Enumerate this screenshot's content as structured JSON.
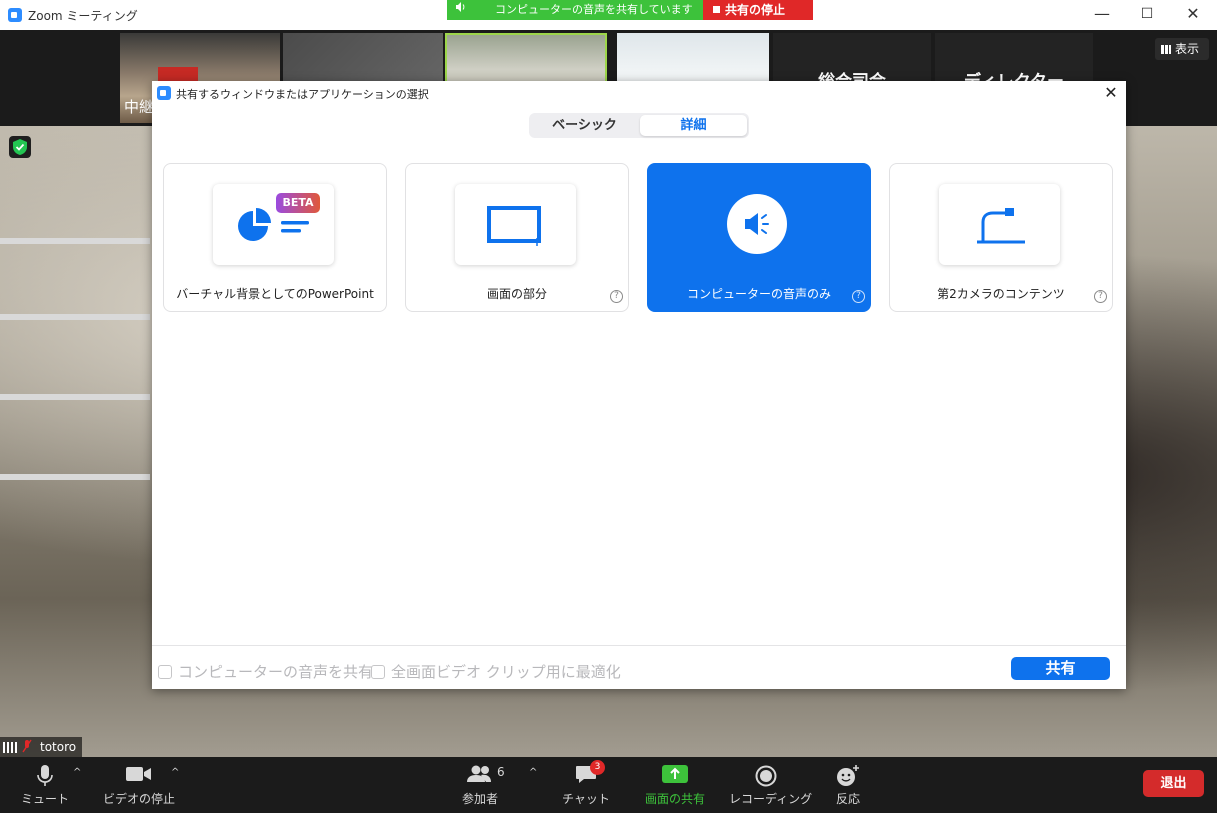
{
  "window": {
    "title": "Zoom ミーティング",
    "minimize": "—",
    "maximize": "☐",
    "close": "✕"
  },
  "share_banner": {
    "status": "コンピューターの音声を共有しています",
    "stop_label": "共有の停止"
  },
  "gallery": {
    "tiles": [
      {
        "name": "中継"
      },
      {
        "name": ""
      },
      {
        "name": ""
      },
      {
        "name": ""
      }
    ],
    "label_tiles": [
      "総合司会",
      "ディレクター"
    ],
    "view_label": "表示"
  },
  "video": {
    "participant_name": "totoro"
  },
  "dialog": {
    "title": "共有するウィンドウまたはアプリケーションの選択",
    "tabs": [
      {
        "label": "ベーシック",
        "selected": false
      },
      {
        "label": "詳細",
        "selected": true
      }
    ],
    "options": [
      {
        "label": "バーチャル背景としてのPowerPoint",
        "badge": "BETA",
        "icon": "powerpoint-chart-icon",
        "selected": false,
        "help": false
      },
      {
        "label": "画面の部分",
        "icon": "screen-portion-icon",
        "selected": false,
        "help": true
      },
      {
        "label": "コンピューターの音声のみ",
        "icon": "speaker-icon",
        "selected": true,
        "help": true
      },
      {
        "label": "第2カメラのコンテンツ",
        "icon": "document-camera-icon",
        "selected": false,
        "help": true
      }
    ],
    "help_glyph": "?",
    "checkboxes": [
      {
        "label": "コンピューターの音声を共有",
        "checked": false,
        "enabled": false
      },
      {
        "label": "全画面ビデオ クリップ用に最適化",
        "checked": false,
        "enabled": false
      }
    ],
    "share_button": "共有"
  },
  "toolbar": {
    "mute": "ミュート",
    "video": "ビデオの停止",
    "participants": "参加者",
    "participants_count": "6",
    "chat": "チャット",
    "chat_badge": "3",
    "share": "画面の共有",
    "record": "レコーディング",
    "reactions": "反応",
    "leave": "退出",
    "caret": "^"
  },
  "colors": {
    "accent_blue": "#0e72ed",
    "share_green": "#3dc23b",
    "stop_red": "#e02828"
  }
}
